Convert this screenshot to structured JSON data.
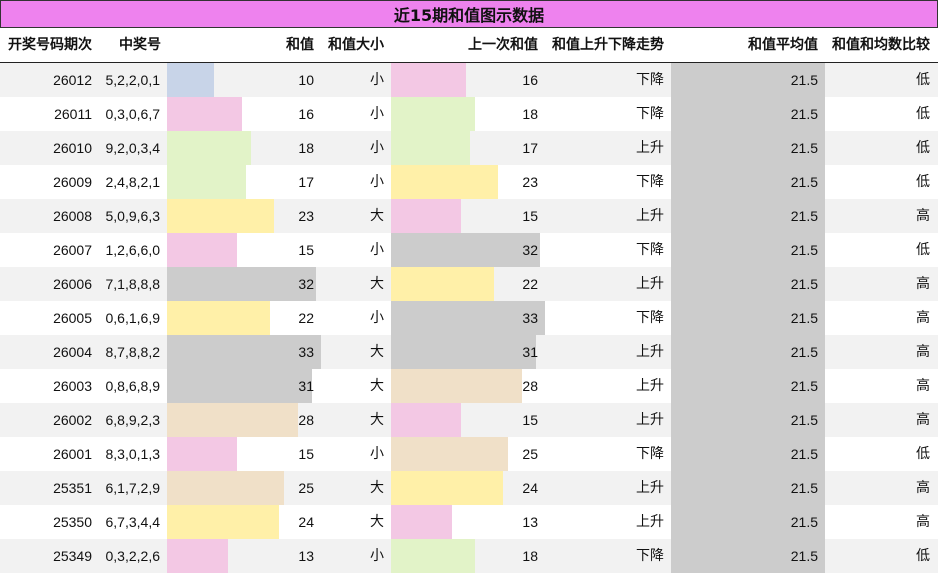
{
  "title": "近15期和值图示数据",
  "headers": [
    "开奖号码期次",
    "中奖号",
    "和值",
    "和值大小",
    "上一次和值",
    "和值上升下降走势",
    "和值平均值",
    "和值和均数比较"
  ],
  "colors": {
    "title_bg": "#ee82ee",
    "avg_bg": "#cccccc",
    "row_odd": "#f2f2f2",
    "row_even": "#ffffff",
    "sum_buckets": {
      "10": "#c8d4e8",
      "13-16": "#f3c8e4",
      "17-18": "#e2f3c8",
      "22-24": "#fff0a8",
      "25-28": "#f0e0c8",
      "31-33": "#cccccc"
    }
  },
  "chart_data": {
    "type": "table",
    "title": "近15期和值图示数据",
    "columns": [
      "开奖号码期次",
      "中奖号",
      "和值",
      "和值大小",
      "上一次和值",
      "和值上升下降走势",
      "和值平均值",
      "和值和均数比较"
    ],
    "max_sum": 33,
    "rows": [
      {
        "issue": "26012",
        "numbers": "5,2,2,0,1",
        "sum": 10,
        "size": "小",
        "prev_sum": 16,
        "trend": "下降",
        "avg": "21.5",
        "compare": "低"
      },
      {
        "issue": "26011",
        "numbers": "0,3,0,6,7",
        "sum": 16,
        "size": "小",
        "prev_sum": 18,
        "trend": "下降",
        "avg": "21.5",
        "compare": "低"
      },
      {
        "issue": "26010",
        "numbers": "9,2,0,3,4",
        "sum": 18,
        "size": "小",
        "prev_sum": 17,
        "trend": "上升",
        "avg": "21.5",
        "compare": "低"
      },
      {
        "issue": "26009",
        "numbers": "2,4,8,2,1",
        "sum": 17,
        "size": "小",
        "prev_sum": 23,
        "trend": "下降",
        "avg": "21.5",
        "compare": "低"
      },
      {
        "issue": "26008",
        "numbers": "5,0,9,6,3",
        "sum": 23,
        "size": "大",
        "prev_sum": 15,
        "trend": "上升",
        "avg": "21.5",
        "compare": "高"
      },
      {
        "issue": "26007",
        "numbers": "1,2,6,6,0",
        "sum": 15,
        "size": "小",
        "prev_sum": 32,
        "trend": "下降",
        "avg": "21.5",
        "compare": "低"
      },
      {
        "issue": "26006",
        "numbers": "7,1,8,8,8",
        "sum": 32,
        "size": "大",
        "prev_sum": 22,
        "trend": "上升",
        "avg": "21.5",
        "compare": "高"
      },
      {
        "issue": "26005",
        "numbers": "0,6,1,6,9",
        "sum": 22,
        "size": "小",
        "prev_sum": 33,
        "trend": "下降",
        "avg": "21.5",
        "compare": "高"
      },
      {
        "issue": "26004",
        "numbers": "8,7,8,8,2",
        "sum": 33,
        "size": "大",
        "prev_sum": 31,
        "trend": "上升",
        "avg": "21.5",
        "compare": "高"
      },
      {
        "issue": "26003",
        "numbers": "0,8,6,8,9",
        "sum": 31,
        "size": "大",
        "prev_sum": 28,
        "trend": "上升",
        "avg": "21.5",
        "compare": "高"
      },
      {
        "issue": "26002",
        "numbers": "6,8,9,2,3",
        "sum": 28,
        "size": "大",
        "prev_sum": 15,
        "trend": "上升",
        "avg": "21.5",
        "compare": "高"
      },
      {
        "issue": "26001",
        "numbers": "8,3,0,1,3",
        "sum": 15,
        "size": "小",
        "prev_sum": 25,
        "trend": "下降",
        "avg": "21.5",
        "compare": "低"
      },
      {
        "issue": "25351",
        "numbers": "6,1,7,2,9",
        "sum": 25,
        "size": "大",
        "prev_sum": 24,
        "trend": "上升",
        "avg": "21.5",
        "compare": "高"
      },
      {
        "issue": "25350",
        "numbers": "6,7,3,4,4",
        "sum": 24,
        "size": "大",
        "prev_sum": 13,
        "trend": "上升",
        "avg": "21.5",
        "compare": "高"
      },
      {
        "issue": "25349",
        "numbers": "0,3,2,2,6",
        "sum": 13,
        "size": "小",
        "prev_sum": 18,
        "trend": "下降",
        "avg": "21.5",
        "compare": "低"
      }
    ]
  }
}
